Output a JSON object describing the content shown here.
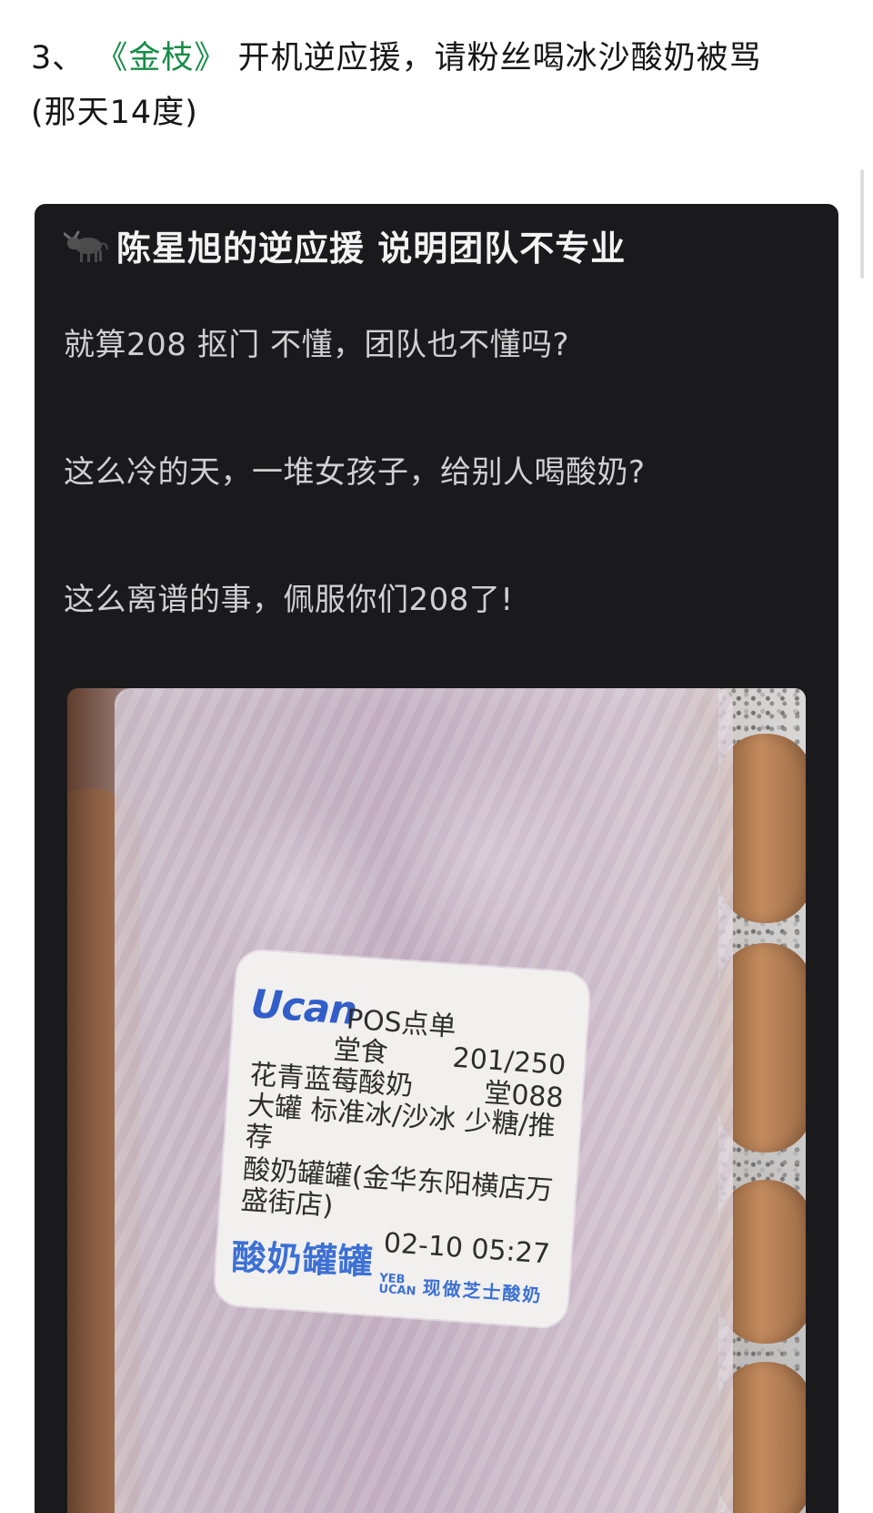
{
  "headline": {
    "prefix": "3、",
    "show_title": "《金枝》",
    "suffix": "开机逆应援，请粉丝喝冰沙酸奶被骂",
    "line2": "(那天14度)"
  },
  "post": {
    "title": "陈星旭的逆应援 说明团队不专业",
    "lines": [
      "就算208 抠门 不懂，团队也不懂吗?",
      "这么冷的天，一堆女孩子，给别人喝酸奶?",
      "这么离谱的事，佩服你们208了!"
    ]
  },
  "receipt": {
    "logo": "Ucan",
    "line1": "POS点单",
    "line2": "堂食",
    "line3": "花青蓝莓酸奶",
    "line4": "大罐 标准冰/沙冰 少糖/推",
    "line5": "荐",
    "line6": "酸奶罐罐(金华东阳横店万",
    "line7": "盛街店)",
    "time": "02-10 05:27",
    "order_count": "201/250",
    "table_no": "堂088",
    "brand": "酸奶罐罐",
    "brand_mini_1": "YEB",
    "brand_mini_2": "UCAN",
    "slogan": "现做芝士酸奶"
  }
}
